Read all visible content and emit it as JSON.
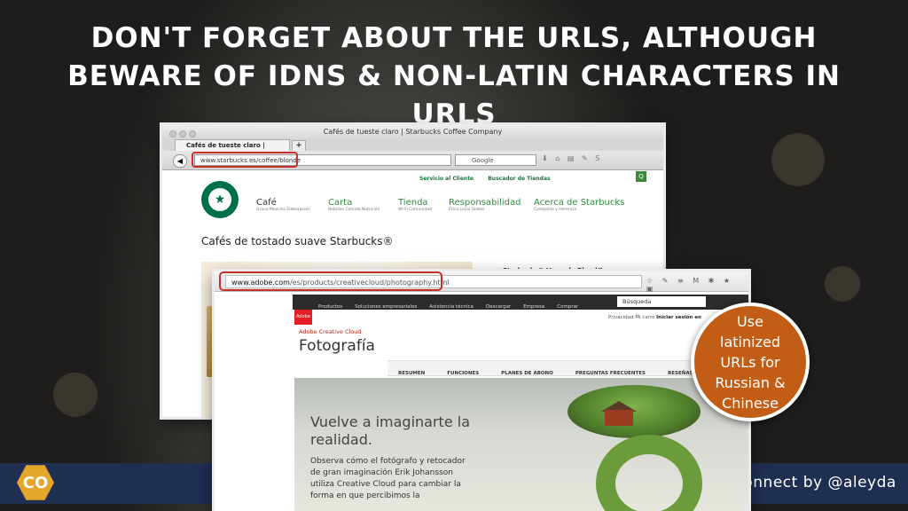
{
  "slide": {
    "title": "DON'T FORGET ABOUT THE URLS, ALTHOUGH BEWARE OF IDNS & NON-LATIN CHARACTERS IN URLS",
    "footer": "Connect by @aleyda",
    "logo_glyph": "CO",
    "callout": "Use latinized URLs for Russian & Chinese"
  },
  "window1": {
    "window_title": "Cafés de tueste claro | Starbucks Coffee Company",
    "tab_label": "Cafés de tueste claro | Starbuck...",
    "new_tab": "+",
    "url": "www.starbucks.es/coffee/blonde",
    "search_placeholder": "Google",
    "top_links": [
      "Servicio al Cliente",
      "Buscador de Tiendas"
    ],
    "menu": [
      {
        "label": "Café",
        "sub": "Grano Mezclas Elaboración"
      },
      {
        "label": "Carta",
        "sub": "Bebidas Comida Nutrición"
      },
      {
        "label": "Tienda",
        "sub": "Wi-Fi Comunidad"
      },
      {
        "label": "Responsabilidad",
        "sub": "Ética Local Global"
      },
      {
        "label": "Acerca de Starbucks",
        "sub": "Compañía y Herencia"
      }
    ],
    "heading": "Cafés de tostado suave Starbucks®",
    "side_text": "Starbucks® Veranda Blend™"
  },
  "window2": {
    "url_host": "www.adobe.com",
    "url_path": "/es/products/creativecloud/photography.html",
    "menu": [
      "Productos",
      "Soluciones empresariales",
      "Asistencia técnica",
      "Descargar",
      "Empresa",
      "Comprar"
    ],
    "search_placeholder": "Búsqueda",
    "util_links": "Privacidad   Mi carro",
    "signin": "Iniciar sesión en",
    "adobe_logo": "Adobe",
    "brand": "Adobe Creative Cloud",
    "page_title": "Fotografía",
    "tabs": [
      "RESUMEN",
      "FUNCIONES",
      "PLANES DE ABONO",
      "PREGUNTAS FRECUENTES",
      "RESEÑAS"
    ],
    "hero_heading": "Vuelve a imaginarte la realidad.",
    "hero_text": "Observa cómo el fotógrafo y retocador de gran imaginación Erik Johansson utiliza Creative Cloud para cambiar la forma en que percibimos la"
  }
}
